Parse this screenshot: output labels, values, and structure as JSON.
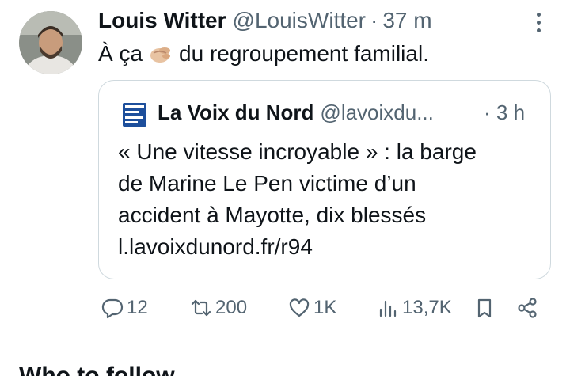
{
  "tweet": {
    "author_name": "Louis Witter",
    "author_handle": "@LouisWitter",
    "separator": "·",
    "time": "37 m",
    "text_before": "À ça",
    "text_after": "du regroupement familial.",
    "emoji": "pinching-hand-emoji"
  },
  "quote": {
    "author_name": "La Voix du Nord",
    "author_handle": "@lavoixdu...",
    "time": "· 3 h",
    "lines": [
      "« Une vitesse incroyable » : la barge",
      "de Marine Le Pen victime d’un",
      "accident à Mayotte, dix blessés",
      "l.lavoixdunord.fr/r94"
    ]
  },
  "actions": {
    "replies": "12",
    "retweets": "200",
    "likes": "1K",
    "views": "13,7K"
  },
  "next_section": {
    "title": "Who to follow"
  },
  "colors": {
    "text": "#0f1419",
    "secondary": "#536471",
    "border": "#cfd9de",
    "logo_blue": "#1d4f9c"
  }
}
